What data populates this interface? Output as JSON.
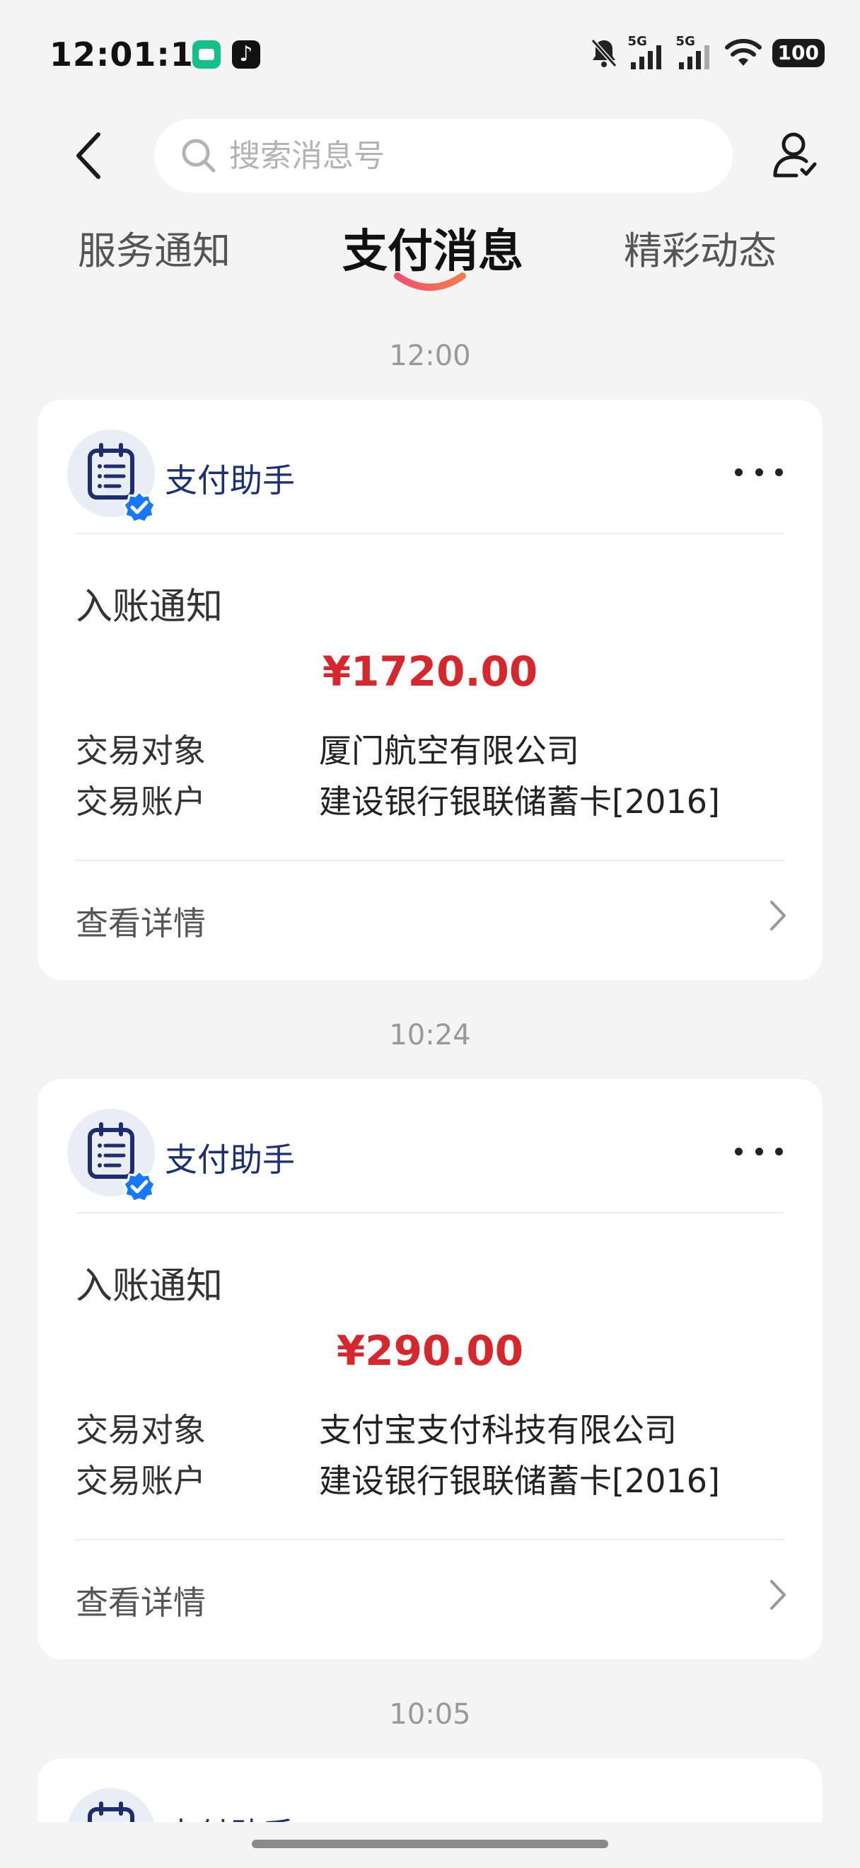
{
  "status_bar": {
    "time": "12:01:17",
    "signal_1_label": "5G",
    "signal_2_label": "5G",
    "battery": "100",
    "icons": [
      "app-green-icon",
      "tiktok-icon",
      "bell-muted-icon",
      "signal-icon",
      "signal-icon",
      "wifi-icon",
      "battery-icon"
    ]
  },
  "header": {
    "back_icon": "back-arrow-icon",
    "search_placeholder": "搜索消息号",
    "profile_icon": "user-check-icon"
  },
  "tabs": [
    {
      "label": "服务通知",
      "active": false
    },
    {
      "label": "支付消息",
      "active": true
    },
    {
      "label": "精彩动态",
      "active": false
    }
  ],
  "accent_color": "#f0506e",
  "amount_color": "#d7262c",
  "messages": [
    {
      "time": "12:00",
      "sender": "支付助手",
      "title": "入账通知",
      "amount": "¥1720.00",
      "fields": [
        {
          "label": "交易对象",
          "value": "厦门航空有限公司"
        },
        {
          "label": "交易账户",
          "value": "建设银行银联储蓄卡[2016]"
        }
      ],
      "detail_label": "查看详情"
    },
    {
      "time": "10:24",
      "sender": "支付助手",
      "title": "入账通知",
      "amount": "¥290.00",
      "fields": [
        {
          "label": "交易对象",
          "value": "支付宝支付科技有限公司"
        },
        {
          "label": "交易账户",
          "value": "建设银行银联储蓄卡[2016]"
        }
      ],
      "detail_label": "查看详情"
    },
    {
      "time": "10:05",
      "sender": "支付助手"
    }
  ]
}
